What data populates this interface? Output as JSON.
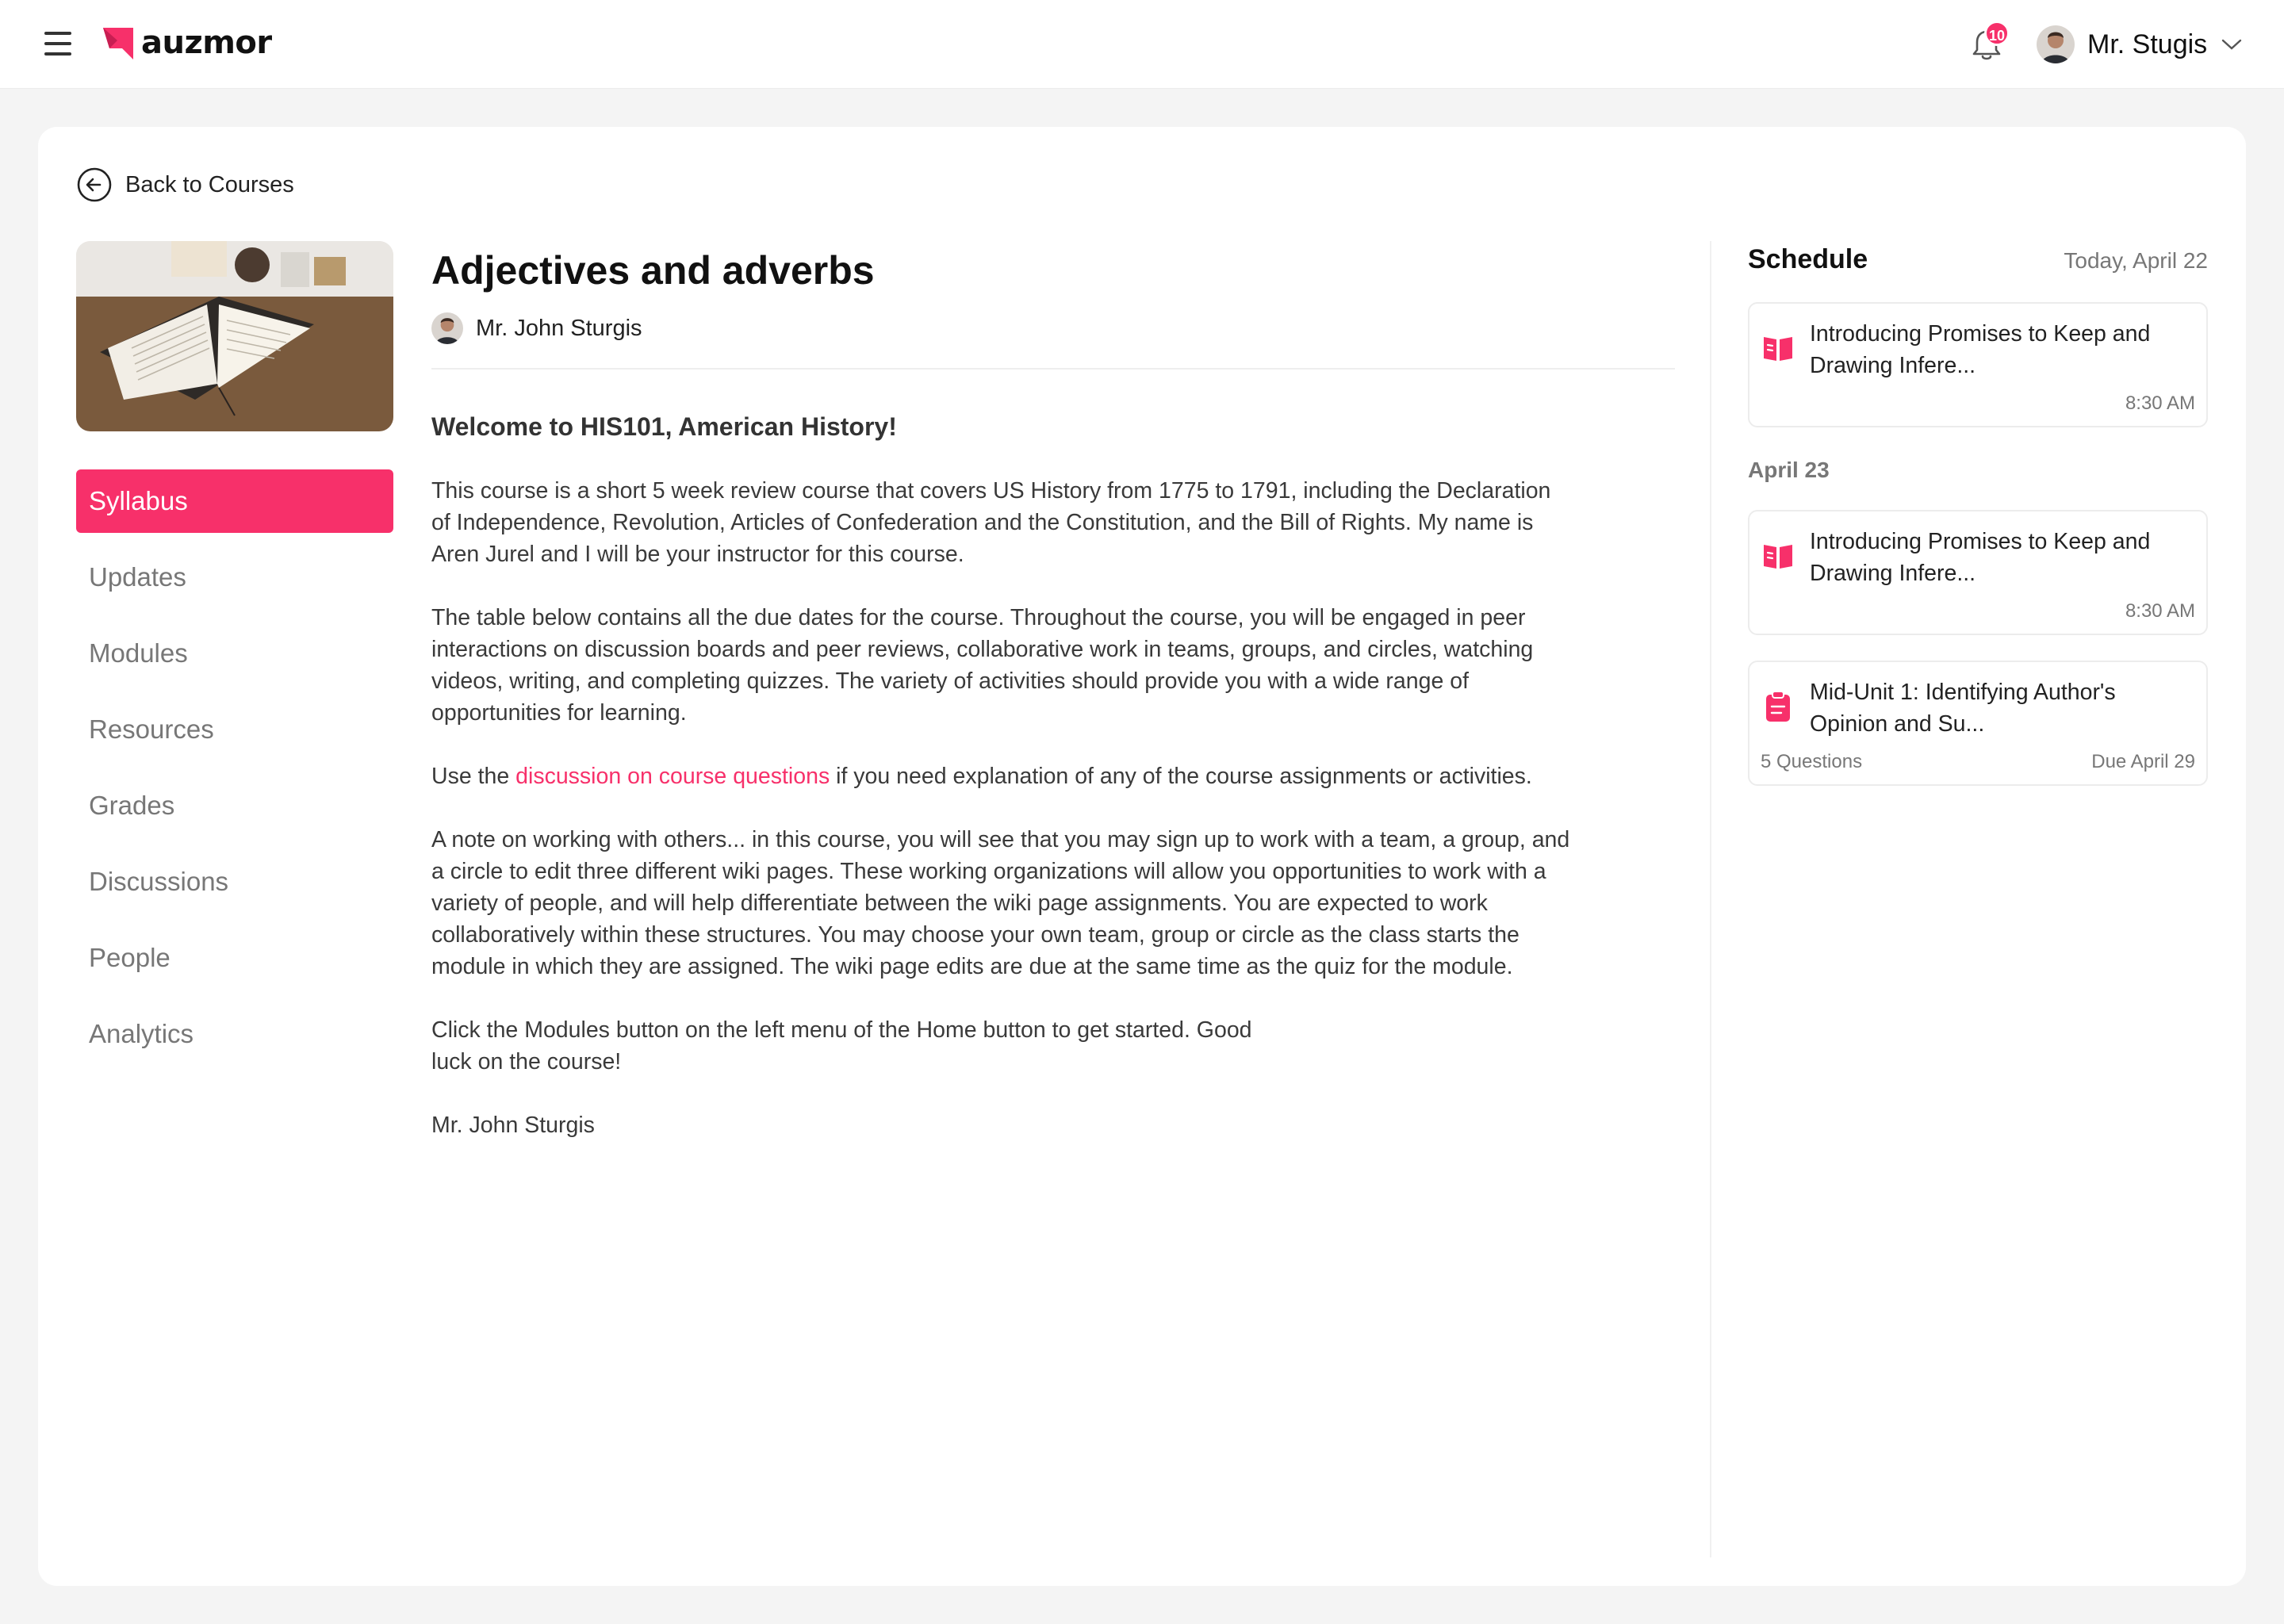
{
  "header": {
    "brand": "auzmor",
    "notification_count": "10",
    "user_name": "Mr. Stugis"
  },
  "back_link": {
    "label": "Back to Courses"
  },
  "sidebar": {
    "items": [
      {
        "label": "Syllabus",
        "active": true
      },
      {
        "label": "Updates"
      },
      {
        "label": "Modules"
      },
      {
        "label": "Resources"
      },
      {
        "label": "Grades"
      },
      {
        "label": "Discussions"
      },
      {
        "label": "People"
      },
      {
        "label": "Analytics"
      }
    ]
  },
  "course": {
    "title": "Adjectives and adverbs",
    "instructor": "Mr. John Sturgis",
    "welcome": "Welcome to HIS101, American History!",
    "p1": "This course is a short 5 week review course that covers US History from 1775 to 1791, including the Declaration of Independence, Revolution, Articles of Confederation and the Constitution, and the Bill of Rights. My name is Aren Jurel and I will be your instructor for this course.",
    "p2": "The table below contains all the due dates for the course. Throughout the course, you will be engaged in peer interactions on discussion boards and peer reviews, collaborative work in teams, groups, and circles, watching videos, writing, and completing quizzes. The variety of activities should provide you with a wide range of opportunities for learning.",
    "p3_before": "Use the ",
    "p3_link": "discussion on course questions",
    "p3_after": " if you need explanation of any of the course assignments or activities.",
    "p4": "A note on working with others... in this course, you will see that you may sign up to work with a team, a group, and a circle to edit three different wiki pages. These working organizations will allow you opportunities to work with a variety of people, and will help differentiate between the wiki page assignments. You are expected to work collaboratively within these structures. You may choose your own team, group or circle as the class starts the module in which they are assigned. The wiki page edits are due at the same time as the quiz for the module.",
    "p5": "Click the Modules button on the left menu of the Home button to get started. Good luck on the course!",
    "signature": "Mr. John Sturgis"
  },
  "schedule": {
    "title": "Schedule",
    "today": "Today, April 22",
    "items_today": [
      {
        "icon": "book-open-icon",
        "title": "Introducing Promises to Keep and Drawing Infere...",
        "time": "8:30 AM"
      }
    ],
    "next_day_label": "April 23",
    "items_next": [
      {
        "icon": "book-open-icon",
        "title": "Introducing Promises to Keep and Drawing Infere...",
        "time": "8:30 AM"
      },
      {
        "icon": "clipboard-icon",
        "title": "Mid-Unit 1: Identifying Author's Opinion and Su...",
        "questions": "5 Questions",
        "due": "Due April 29"
      }
    ]
  },
  "colors": {
    "accent": "#f7306a",
    "text": "#222222",
    "muted": "#777777"
  }
}
